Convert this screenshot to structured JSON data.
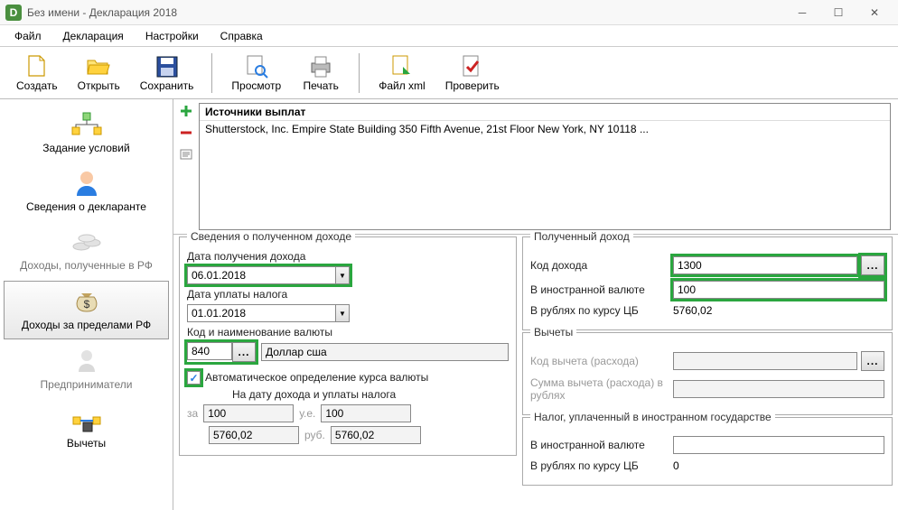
{
  "window": {
    "title": "Без имени - Декларация 2018"
  },
  "menu": {
    "file": "Файл",
    "declaration": "Декларация",
    "settings": "Настройки",
    "help": "Справка"
  },
  "toolbar": {
    "create": "Создать",
    "open": "Открыть",
    "save": "Сохранить",
    "preview": "Просмотр",
    "print": "Печать",
    "file_xml": "Файл xml",
    "check": "Проверить"
  },
  "sidebar": {
    "conditions": "Задание условий",
    "declarant": "Сведения о декларанте",
    "income_rf": "Доходы, полученные в РФ",
    "income_foreign": "Доходы за пределами РФ",
    "entrepreneurs": "Предприниматели",
    "deductions": "Вычеты"
  },
  "sources": {
    "header": "Источники выплат",
    "items": [
      "Shutterstock, Inc. Empire State Building 350 Fifth Avenue, 21st Floor New York, NY 10118 ..."
    ]
  },
  "income_info": {
    "group": "Сведения о полученном доходе",
    "date_received_label": "Дата получения дохода",
    "date_received": "06.01.2018",
    "date_paid_label": "Дата уплаты налога",
    "date_paid": "01.01.2018",
    "currency_label": "Код и наименование валюты",
    "currency_code": "840",
    "currency_name": "Доллар сша",
    "auto_rate": "✓",
    "auto_rate_label": "Автоматическое определение курса валюты",
    "on_date_label": "На дату дохода и уплаты налога",
    "za": "за",
    "ue": "у.е.",
    "rub": "руб.",
    "za_val1": "100",
    "ue_val1": "100",
    "rate_val1": "5760,02",
    "rate_val2": "5760,02"
  },
  "received": {
    "group": "Полученный доход",
    "code_label": "Код дохода",
    "code": "1300",
    "foreign_label": "В иностранной валюте",
    "foreign": "100",
    "rub_label": "В рублях по курсу ЦБ",
    "rub": "5760,02"
  },
  "deduction": {
    "group": "Вычеты",
    "code_label": "Код вычета (расхода)",
    "sum_label": "Сумма вычета (расхода) в рублях"
  },
  "tax_paid": {
    "group": "Налог, уплаченный в иностранном государстве",
    "foreign_label": "В иностранной валюте",
    "foreign": "",
    "rub_label": "В рублях по курсу ЦБ",
    "rub": "0"
  }
}
